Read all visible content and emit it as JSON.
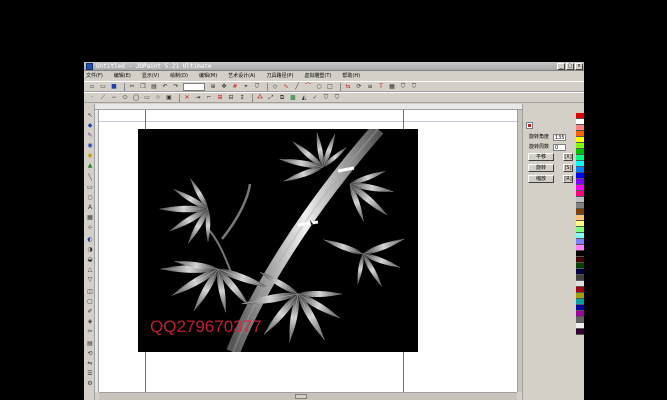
{
  "window": {
    "title": "Untitled - JDPaint 5.21 Ultimate",
    "buttons": {
      "minimize": "_",
      "maximize": "□",
      "close": "×"
    }
  },
  "menubar": {
    "items": [
      "文件(F)",
      "编辑(E)",
      "显示(V)",
      "绘制(D)",
      "编辑(M)",
      "艺术设计(A)",
      "刀具路径(P)",
      "虚拟雕塑(T)",
      "帮助(H)"
    ]
  },
  "toolbar1": {
    "tools": [
      "new-icon",
      "open-icon",
      "save-icon",
      "print-icon",
      "cut-icon",
      "copy-icon",
      "paste-icon",
      "undo-icon",
      "redo-icon",
      "zoom-icon",
      "pan-icon",
      "grid-icon",
      "snap-icon",
      "shield-icon",
      "node-icon",
      "curve-icon",
      "line-icon",
      "arc-icon",
      "circle-icon",
      "rect-icon",
      "polygon-icon",
      "text-icon",
      "layer-icon",
      "mirror-icon",
      "rotate-icon",
      "align-icon",
      "shield2-icon"
    ]
  },
  "toolbar2": {
    "tools": [
      "point-icon",
      "line-icon",
      "polyline-icon",
      "arc-icon",
      "circle-icon",
      "ellipse-icon",
      "rect-icon",
      "star-icon",
      "image-icon",
      "offset-icon",
      "trim-icon",
      "extend-icon",
      "fillet-icon",
      "close-icon",
      "join-icon",
      "break-icon",
      "transform-icon",
      "array-icon",
      "scale-icon",
      "mesh-icon",
      "relief-icon",
      "check-icon",
      "shield3-icon"
    ]
  },
  "panel": {
    "rows": [
      {
        "label": "旋转角度",
        "value": "135.1"
      },
      {
        "label": "旋转周数",
        "value": "0"
      }
    ],
    "buttons": [
      "平移",
      "旋转",
      "缩放"
    ],
    "side_buttons": [
      "[X]",
      "[S]",
      "[R]"
    ]
  },
  "palette": {
    "colors": [
      "#e00000",
      "#ffffff",
      "#ff8080",
      "#ff6000",
      "#ffff00",
      "#80ff00",
      "#00c000",
      "#00ff80",
      "#00ffff",
      "#0080ff",
      "#0000ff",
      "#8000ff",
      "#ff00ff",
      "#ff0080",
      "#c0c0c0",
      "#808080",
      "#804000",
      "#ffc080",
      "#ffff80",
      "#80ff80",
      "#80ffff",
      "#8080ff",
      "#ff80ff",
      "#000000",
      "#400000",
      "#004000",
      "#000040",
      "#404040",
      "#e0e0e0",
      "#a00000",
      "#a0a000",
      "#00a0a0",
      "#0000a0",
      "#a000a0",
      "#606060",
      "#f0f0f0",
      "#300030"
    ]
  },
  "watermark": "QQ279670377"
}
